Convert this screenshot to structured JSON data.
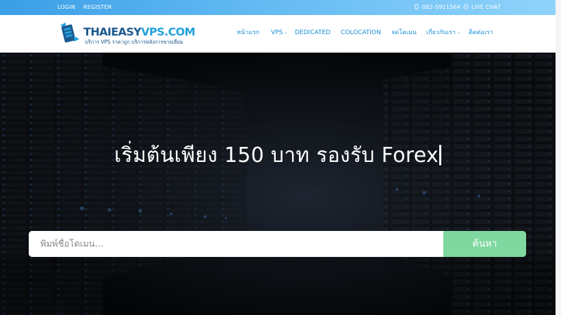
{
  "topbar": {
    "login": "LOGIN",
    "register": "REGISTER",
    "phone": "082-5911564",
    "live_chat": "LIVE CHAT"
  },
  "logo": {
    "name_part1": "THAIEASY",
    "name_part2": "VPS.COM",
    "tagline": "บริการ VPS ราคาถูก บริการหลังการขายเยี่ยม"
  },
  "nav": {
    "home": "หน้าแรก",
    "vps": "VPS",
    "dedicated": "DEDICATED",
    "colocation": "COLOCATION",
    "domain": "จดโดเมน",
    "about": "เกี่ยวกับเรา",
    "contact": "ติดต่อเรา"
  },
  "hero": {
    "headline": "เริ่มต้นเพียง 150 บาท รองรับ Forex"
  },
  "search": {
    "placeholder": "พิมพ์ชื่อโดเมน...",
    "button_label": "ค้นหา"
  },
  "colors": {
    "topbar_start": "#3b9fe6",
    "topbar_end": "#8fd3fa",
    "nav_text": "#1a8fd6",
    "logo_dark": "#1c5a8f",
    "logo_light": "#23a1dc",
    "search_button": "#7fd8a0"
  },
  "icons": {
    "phone": "phone-icon",
    "chat": "chat-icon",
    "caret": "chevron-down-icon"
  }
}
